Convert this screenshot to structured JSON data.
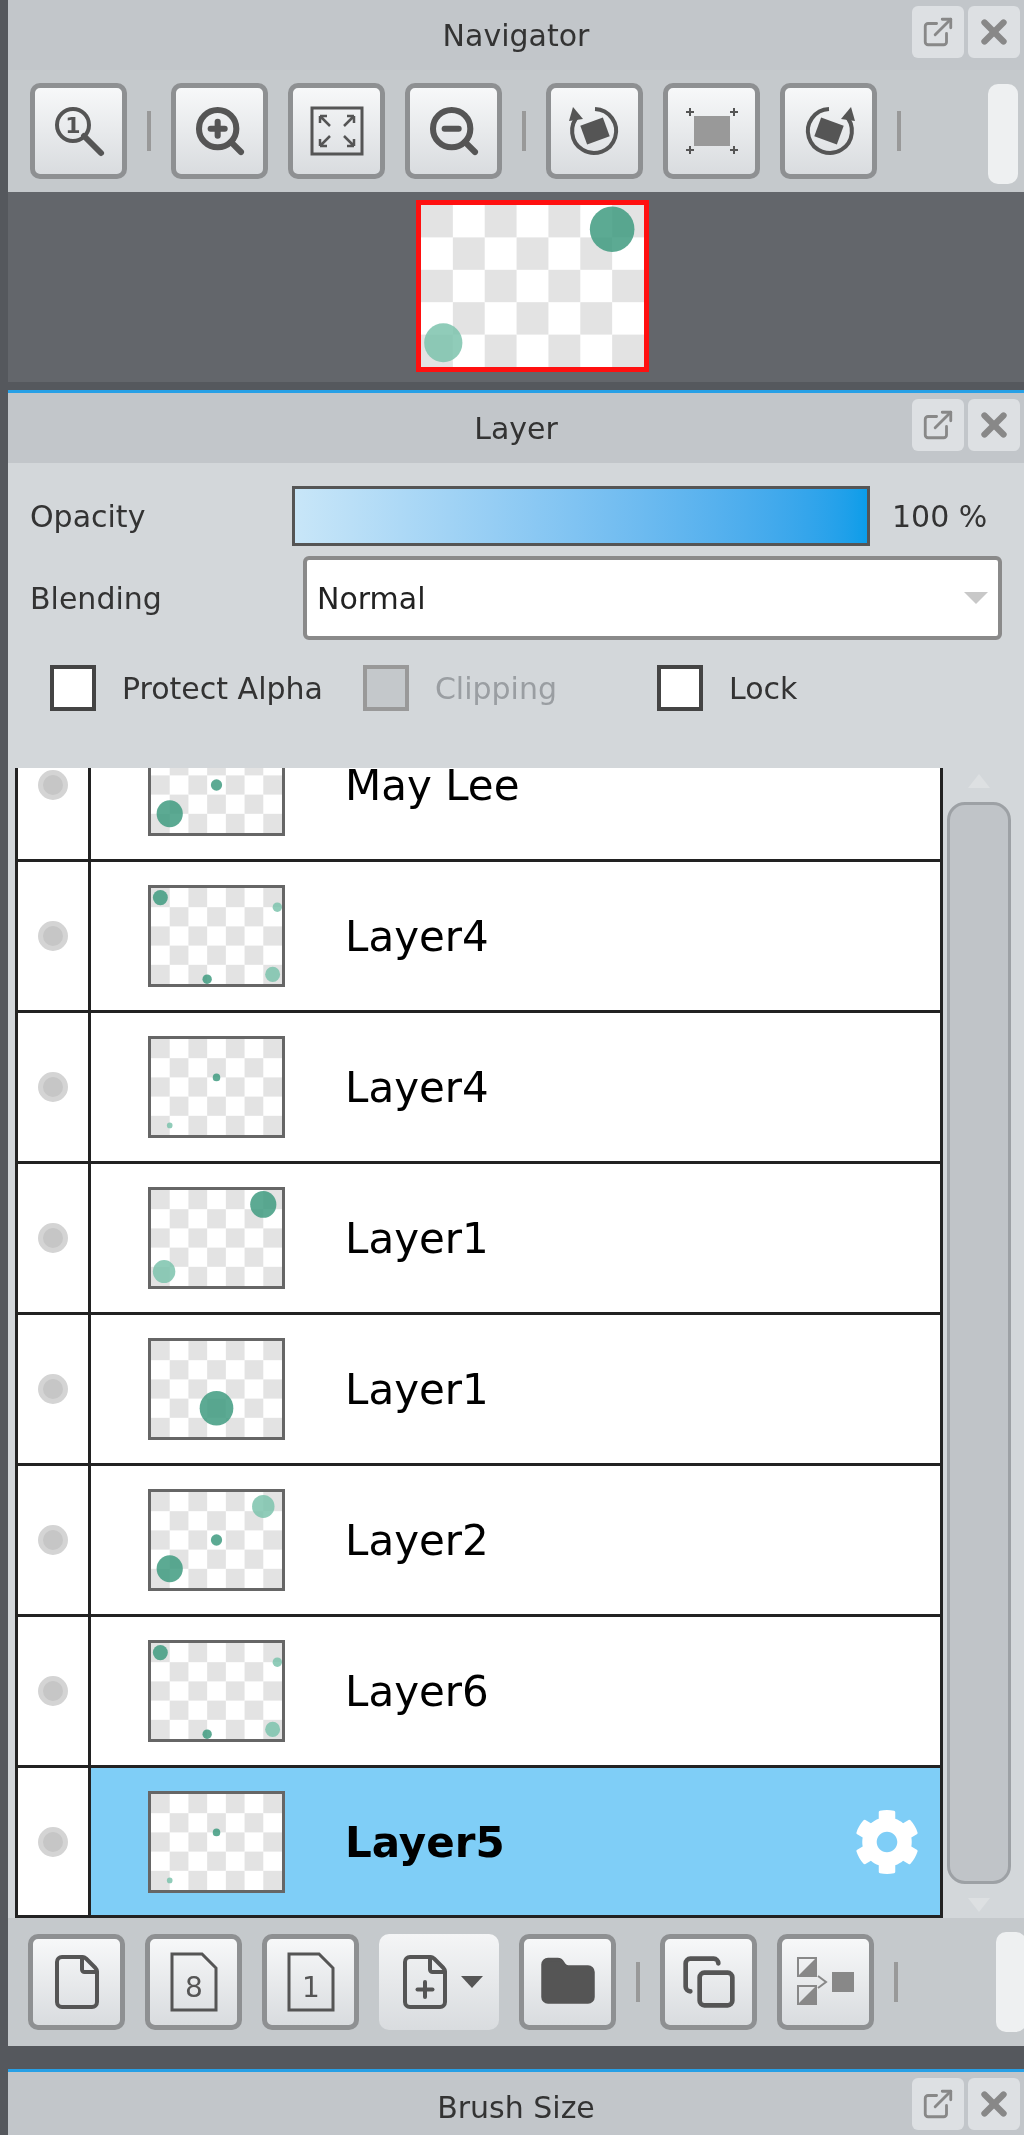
{
  "navigator": {
    "title": "Navigator",
    "toolbar": [
      {
        "kind": "zoom-actual",
        "label": "1"
      },
      {
        "kind": "separator"
      },
      {
        "kind": "zoom-in"
      },
      {
        "kind": "fit"
      },
      {
        "kind": "zoom-out"
      },
      {
        "kind": "separator"
      },
      {
        "kind": "rotate-left"
      },
      {
        "kind": "reset-rotation"
      },
      {
        "kind": "rotate-right"
      },
      {
        "kind": "separator"
      }
    ]
  },
  "layer_panel": {
    "title": "Layer",
    "opacity": {
      "label": "Opacity",
      "level": 1.0,
      "reading": "100 %"
    },
    "blending": {
      "label": "Blending",
      "value": "Normal"
    },
    "options": [
      {
        "label": "Protect Alpha",
        "checked": false,
        "disabled": false
      },
      {
        "label": "Clipping",
        "checked": false,
        "disabled": true
      },
      {
        "label": "Lock",
        "checked": false,
        "disabled": false
      }
    ],
    "layers": [
      {
        "name": "May Lee",
        "selected": false
      },
      {
        "name": "Layer4",
        "selected": false
      },
      {
        "name": "Layer4",
        "selected": false
      },
      {
        "name": "Layer1",
        "selected": false
      },
      {
        "name": "Layer1",
        "selected": false
      },
      {
        "name": "Layer2",
        "selected": false
      },
      {
        "name": "Layer6",
        "selected": false
      },
      {
        "name": "Layer5",
        "selected": true
      }
    ],
    "toolbar": [
      {
        "kind": "new-layer"
      },
      {
        "kind": "new-numbered",
        "label": "8"
      },
      {
        "kind": "new-numbered",
        "label": "1"
      },
      {
        "kind": "add-menu"
      },
      {
        "kind": "folder"
      },
      {
        "kind": "separator"
      },
      {
        "kind": "duplicate"
      },
      {
        "kind": "transfer"
      },
      {
        "kind": "separator"
      }
    ]
  },
  "brush_panel": {
    "title": "Brush Size"
  }
}
